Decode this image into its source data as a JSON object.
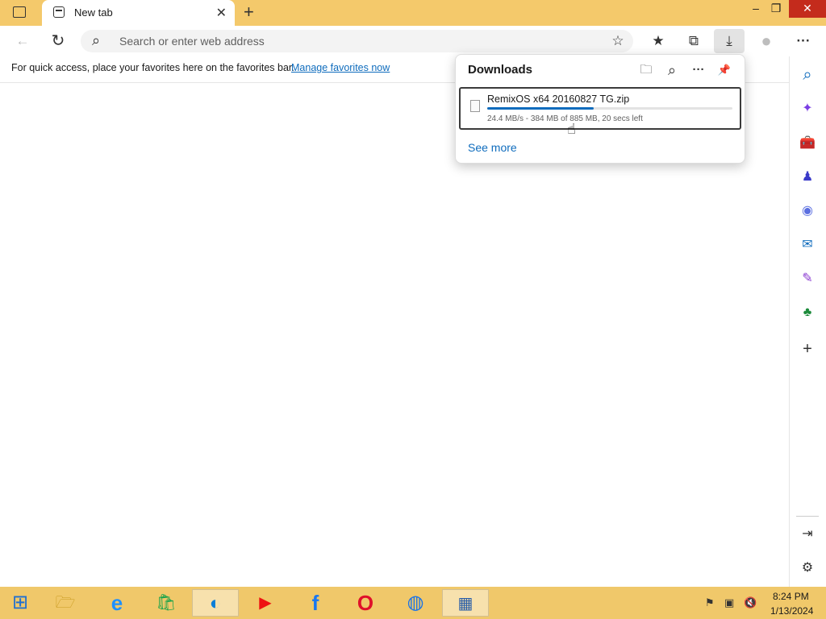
{
  "window": {
    "tab_title": "New tab",
    "tab_close_glyph": "✕",
    "new_tab_glyph": "+",
    "minimize_glyph": "–",
    "restore_glyph": "❐",
    "close_glyph": "✕"
  },
  "toolbar": {
    "back_glyph": "←",
    "refresh_glyph": "↻",
    "search_glyph": "⌕",
    "address_placeholder": "Search or enter web address",
    "add_favorite_glyph": "☆",
    "favorites_glyph": "★",
    "collections_glyph": "⧉",
    "downloads_glyph": "⤓",
    "profile_glyph": "●",
    "more_glyph": "···"
  },
  "favorites_bar": {
    "text": "For quick access, place your favorites here on the favorites bar.",
    "link": "Manage favorites now"
  },
  "downloads": {
    "title": "Downloads",
    "folder_glyph": "🗀",
    "search_glyph": "⌕",
    "more_glyph": "···",
    "pin_glyph": "📌",
    "item": {
      "filename": "RemixOS x64 20160827 TG.zip",
      "status": "24.4 MB/s - 384 MB of 885 MB, 20 secs left",
      "progress": 0.434
    },
    "see_more": "See more"
  },
  "sidebar": {
    "search_glyph": "⌕",
    "copilot_glyph": "✦",
    "shopping_glyph": "🧰",
    "games_glyph": "♟",
    "m365_glyph": "◉",
    "outlook_glyph": "✉",
    "designer_glyph": "✎",
    "tree_glyph": "♣",
    "add_glyph": "+",
    "split_glyph": "⇥",
    "settings_glyph": "⚙"
  },
  "taskbar": {
    "start_glyph": "⊞",
    "explorer_glyph": "🗁",
    "ie_glyph": "e",
    "store_glyph": "🛍",
    "edge_glyph": "◐",
    "youtube_glyph": "▶",
    "facebook_glyph": "f",
    "opera_glyph": "O",
    "chrome_glyph": "◍",
    "server_glyph": "▦",
    "tray_flag_glyph": "⚑",
    "tray_network_glyph": "▣",
    "tray_volume_glyph": "🔇",
    "time": "8:24 PM",
    "date": "1/13/2024"
  },
  "colors": {
    "titlebar": "#f4c96b",
    "accent": "#0f6cbd",
    "close_button": "#c42b1c",
    "taskbar": "#f0c86a"
  }
}
